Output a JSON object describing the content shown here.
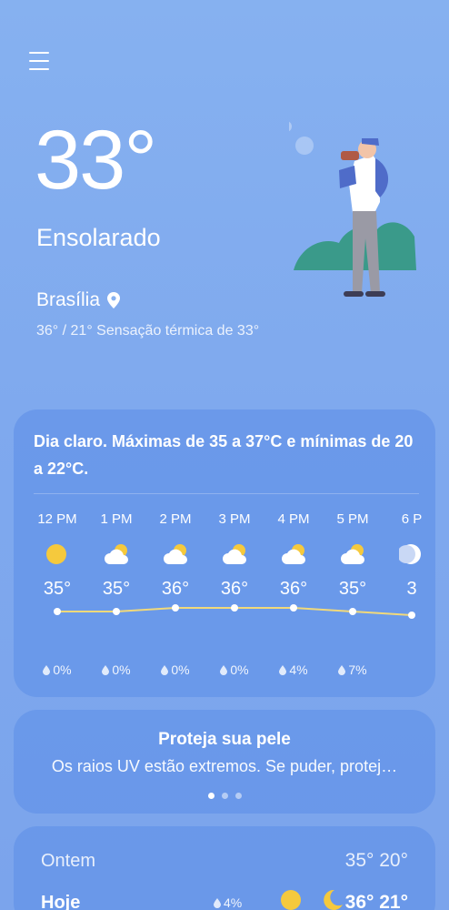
{
  "current": {
    "temperature": "33°",
    "condition": "Ensolarado",
    "city": "Brasília",
    "range_feels": "36° / 21° Sensação térmica de 33°"
  },
  "forecast": {
    "summary": "Dia claro. Máximas de 35 a 37°C e mínimas de 20 a 22°C.",
    "hours": [
      {
        "time": "12 PM",
        "icon": "sun-icon",
        "temp": "35°",
        "precip": "0%"
      },
      {
        "time": "1 PM",
        "icon": "partly-cloudy-icon",
        "temp": "35°",
        "precip": "0%"
      },
      {
        "time": "2 PM",
        "icon": "partly-cloudy-icon",
        "temp": "36°",
        "precip": "0%"
      },
      {
        "time": "3 PM",
        "icon": "partly-cloudy-icon",
        "temp": "36°",
        "precip": "0%"
      },
      {
        "time": "4 PM",
        "icon": "partly-cloudy-icon",
        "temp": "36°",
        "precip": "4%"
      },
      {
        "time": "5 PM",
        "icon": "partly-cloudy-icon",
        "temp": "35°",
        "precip": "7%"
      },
      {
        "time": "6 P",
        "icon": "moon-icon",
        "temp": "3",
        "precip": ""
      }
    ],
    "temp_values": [
      35,
      35,
      36,
      36,
      36,
      35,
      34
    ]
  },
  "skin": {
    "title": "Proteja sua pele",
    "text": "Os raios UV estão extremos. Se puder, protej…"
  },
  "daily": {
    "yesterday_label": "Ontem",
    "yesterday_temps": "35° 20°",
    "today_label": "Hoje",
    "today_precip": "4%",
    "today_temps": "36° 21°"
  },
  "colors": {
    "sun": "#f5c93d",
    "trend_line": "#f1d97a",
    "background": "#86b1f0",
    "card": "#6494e8"
  }
}
